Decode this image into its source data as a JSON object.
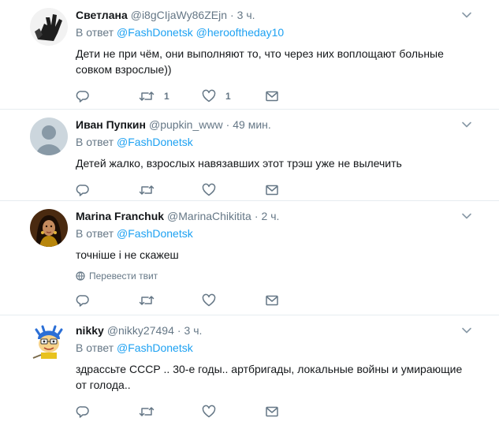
{
  "tweets": [
    {
      "name": "Светлана",
      "handle": "@i8gCIjaWy86ZEjn",
      "time": "3 ч.",
      "reply_prefix": "В ответ",
      "reply_to": [
        "@FashDonetsk",
        "@herooftheday10"
      ],
      "text": "Дети не при чём, они выполняют то, что через них воплощают больные совком взрослые))",
      "replies": "",
      "retweets": "1",
      "likes": "1",
      "avatar_icon": "waving-hand-avatar-icon"
    },
    {
      "name": "Иван Пупкин",
      "handle": "@pupkin_www",
      "time": "49 мин.",
      "reply_prefix": "В ответ",
      "reply_to": [
        "@FashDonetsk"
      ],
      "text": "Детей жалко, взрослых навязавших этот трэш уже не вылечить",
      "replies": "",
      "retweets": "",
      "likes": "",
      "avatar_icon": "default-person-avatar-icon"
    },
    {
      "name": "Marina Franchuk",
      "handle": "@MarinaChikitita",
      "time": "2 ч.",
      "reply_prefix": "В ответ",
      "reply_to": [
        "@FashDonetsk"
      ],
      "text": "точніше і не скажеш",
      "translate": "Перевести твит",
      "replies": "",
      "retweets": "",
      "likes": "",
      "avatar_icon": "woman-photo-avatar-icon"
    },
    {
      "name": "nikky",
      "handle": "@nikky27494",
      "time": "3 ч.",
      "reply_prefix": "В ответ",
      "reply_to": [
        "@FashDonetsk"
      ],
      "text": "здрассьте СССР .. 30-е годы.. артбригады, локальные войны и умирающие от голода..",
      "replies": "",
      "retweets": "",
      "likes": "",
      "avatar_icon": "cartoon-character-avatar-icon"
    }
  ],
  "colors": {
    "link": "#1da1f2",
    "muted": "#657786",
    "text": "#14171a",
    "divider": "#e6ecf0"
  }
}
